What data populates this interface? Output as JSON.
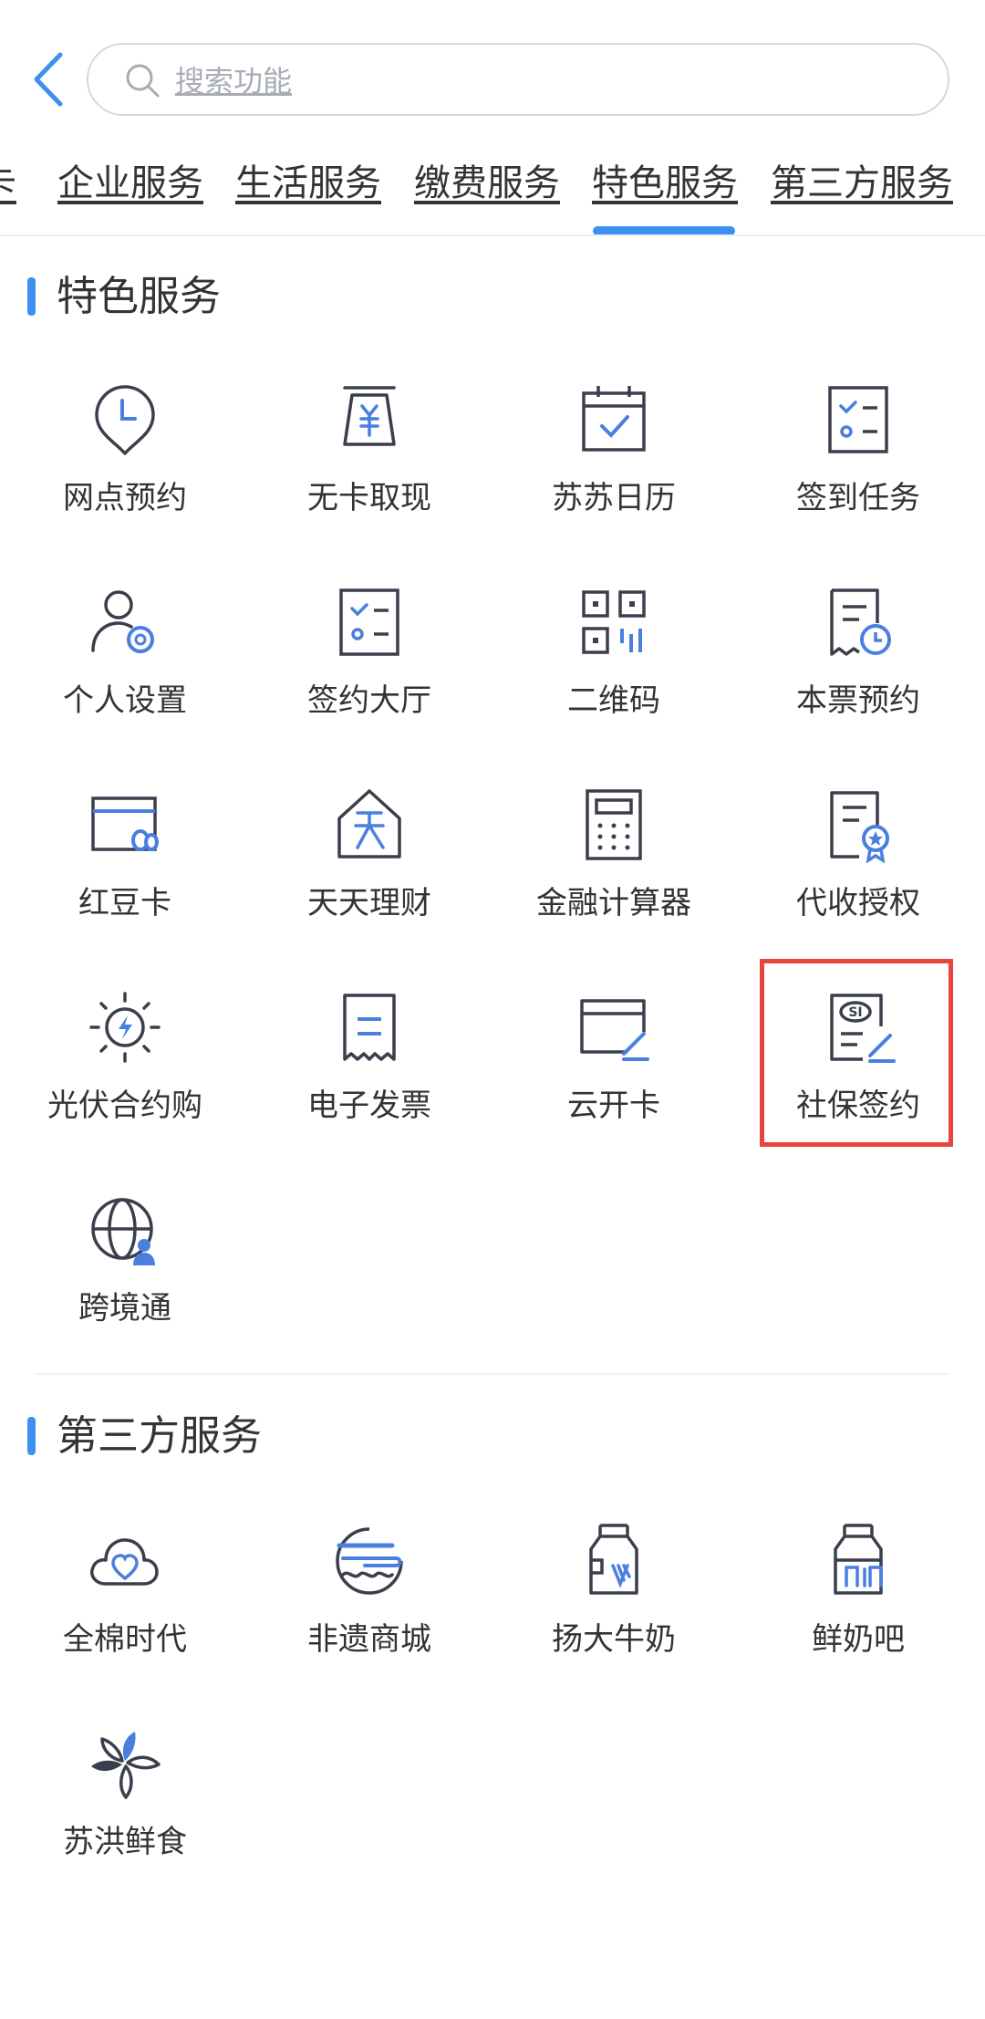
{
  "header": {
    "search": {
      "placeholder": "搜索功能"
    }
  },
  "tabs": [
    {
      "label": "卡"
    },
    {
      "label": "企业服务"
    },
    {
      "label": "生活服务"
    },
    {
      "label": "缴费服务"
    },
    {
      "label": "特色服务",
      "active": true
    },
    {
      "label": "第三方服务"
    }
  ],
  "sections": [
    {
      "title": "特色服务",
      "items": [
        {
          "label": "网点预约",
          "icon": "location-clock-icon"
        },
        {
          "label": "无卡取现",
          "icon": "atm-cash-icon"
        },
        {
          "label": "苏苏日历",
          "icon": "calendar-check-icon"
        },
        {
          "label": "签到任务",
          "icon": "checklist-icon"
        },
        {
          "label": "个人设置",
          "icon": "user-settings-icon"
        },
        {
          "label": "签约大厅",
          "icon": "checklist-icon"
        },
        {
          "label": "二维码",
          "icon": "qrcode-icon"
        },
        {
          "label": "本票预约",
          "icon": "document-clock-icon"
        },
        {
          "label": "红豆卡",
          "icon": "card-icon"
        },
        {
          "label": "天天理财",
          "icon": "house-tian-icon"
        },
        {
          "label": "金融计算器",
          "icon": "calculator-icon"
        },
        {
          "label": "代收授权",
          "icon": "document-badge-icon"
        },
        {
          "label": "光伏合约购",
          "icon": "solar-bolt-icon"
        },
        {
          "label": "电子发票",
          "icon": "receipt-icon"
        },
        {
          "label": "云开卡",
          "icon": "card-pen-icon"
        },
        {
          "label": "社保签约",
          "icon": "social-security-sign-icon"
        },
        {
          "label": "跨境通",
          "icon": "globe-user-icon"
        }
      ]
    },
    {
      "title": "第三方服务",
      "items": [
        {
          "label": "全棉时代",
          "icon": "cloud-heart-icon"
        },
        {
          "label": "非遗商城",
          "icon": "heritage-circle-icon"
        },
        {
          "label": "扬大牛奶",
          "icon": "milk-bottle-icon"
        },
        {
          "label": "鲜奶吧",
          "icon": "milk-bottle-icon"
        },
        {
          "label": "苏洪鲜食",
          "icon": "flower-icon"
        }
      ]
    }
  ],
  "colors": {
    "accent": "#3d8ff0",
    "icon_stroke": "#3a3f4b",
    "icon_accent": "#4a7fe0",
    "highlight": "#e5453b"
  }
}
